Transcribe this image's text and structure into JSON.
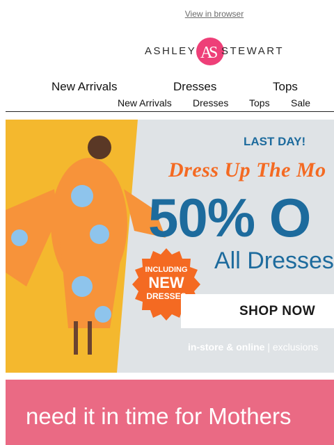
{
  "header": {
    "view_in_browser": "View in browser"
  },
  "logo": {
    "word_left": "ASHLEY",
    "word_right": "STEWART",
    "brand_color": "#ee3f78"
  },
  "nav": {
    "primary": [
      "New Arrivals",
      "Dresses",
      "Tops"
    ],
    "secondary": [
      "New Arrivals",
      "Dresses",
      "Tops",
      "Sale"
    ]
  },
  "hero": {
    "last_day": "LAST DAY!",
    "headline": "Dress Up The Mo",
    "discount": "50% O",
    "subline": "All Dresses",
    "badge": {
      "line1": "INCLUDING",
      "line2": "NEW",
      "line3": "DRESSES",
      "color": "#f46a22"
    },
    "cta": "SHOP NOW",
    "footnote_bold": "in-store & online",
    "footnote_rest": " | exclusions",
    "colors": {
      "background": "#f4b82e",
      "panel": "#dfe3e6",
      "blue": "#1d6b9d",
      "orange": "#f46a22"
    }
  },
  "promo": {
    "text": "need it in time for Mothers",
    "background": "#ea6a84"
  }
}
